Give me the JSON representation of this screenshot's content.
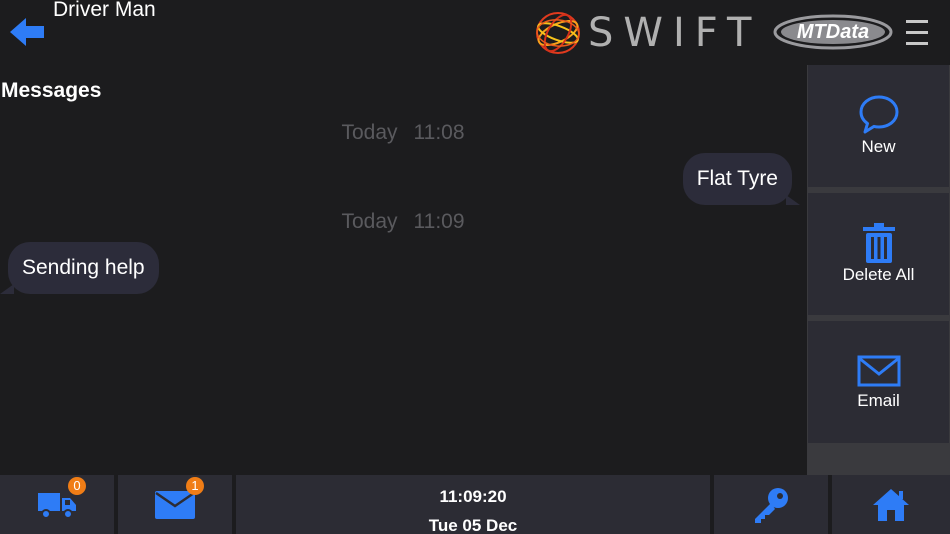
{
  "header": {
    "driver_name": "Driver Man",
    "brand_text": "SWIFT",
    "partner_logo_text": "MTData",
    "back_icon": "arrow-left-icon",
    "menu_icon": "hamburger-menu-icon"
  },
  "messages": {
    "title": "Messages",
    "items": [
      {
        "day": "Today",
        "time": "11:08",
        "text": "Flat Tyre",
        "direction": "outgoing"
      },
      {
        "day": "Today",
        "time": "11:09",
        "text": "Sending help",
        "direction": "incoming"
      }
    ]
  },
  "side_actions": [
    {
      "label": "New",
      "icon": "speech-bubble-icon"
    },
    {
      "label": "Delete All",
      "icon": "trash-icon"
    },
    {
      "label": "Email",
      "icon": "envelope-icon"
    }
  ],
  "bottom_bar": {
    "jobs_badge": "0",
    "messages_badge": "1",
    "time": "11:09:20",
    "date": "Tue 05 Dec",
    "key_icon": "key-icon",
    "home_icon": "home-icon"
  },
  "colors": {
    "accent": "#2e7cf6",
    "badge": "#f07d16",
    "background": "#1c1c1e",
    "bubble": "#2c2c3a",
    "panel": "#2c2c34"
  }
}
